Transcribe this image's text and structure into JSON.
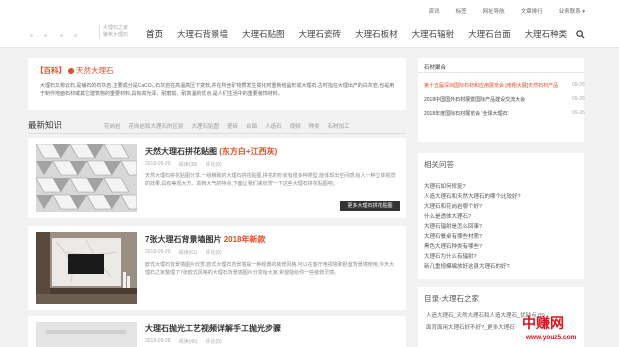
{
  "topbar": {
    "links": [
      "资讯",
      "标签",
      "网址导航",
      "文章排行",
      "业务联系 ▾"
    ]
  },
  "header": {
    "slogan_line1": "大理石之家",
    "slogan_line2": "聚焦大理石",
    "nav": [
      "首页",
      "大理石背景墙",
      "大理石贴图",
      "大理石瓷砖",
      "大理石板材",
      "大理石辐射",
      "大理石台面",
      "大理石种类"
    ],
    "search_icon": "search-icon"
  },
  "intro": {
    "tag": "【百科】",
    "brand": "天然大理石",
    "text": "大理石又称云石,是铺石的石灰岩,主要成分是CaCO₃,石灰岩在高温高压下变软,并在所含矿物质发生变化时重新结晶形成大理石.古时指在大理出产的白灰岩,也是用于制作地面石材或其它建筑物的重要材料,具有高光泽、耐磨损、耐高温的优点,是人们生活中的重要装饰材料。"
  },
  "tabs": {
    "title": "最新知识",
    "items": [
      "花岗岩",
      "花岗岩和大理石的区别",
      "大理石贴图",
      "瓷砖",
      "台面",
      "人造石",
      "视频",
      "种类",
      "石材加工"
    ]
  },
  "cards": [
    {
      "title": "天然大理石拼花贴图",
      "title_red": "(东方白+江西灰)",
      "date": "2018-09-29",
      "views": "阅读(39)",
      "comments": "评论(0)",
      "desc": "天然大理石拼花贴图分享,一组精致的大理石拼花贴图,拼花的形状有很多种类型,能体现出空间感,给人一种立体视觉的效果,具有美观大方、高档大气的特点,下面让我们来欣赏一下这些大理石拼花贴图吧。"
    },
    {
      "title": "7张大理石背景墙图片",
      "title_red": "2018年新款",
      "date": "2018-09-29",
      "views": "阅读(61)",
      "comments": "评论(0)",
      "desc": "欧式大理石背景墙图片欣赏,欧式大理石背景墙是一种经典的装修风格,可以在客厅电视墙和卧室背景墙使用,今天大理石之家整理了7张欧式风格的大理石背景墙图片分享给大家,希望能给你一些装修灵感。"
    },
    {
      "title": "大理石抛光工艺视频详解手工抛光步骤",
      "title_red": "",
      "date": "2018-09-28",
      "views": "阅读(45)",
      "comments": "评论(0)",
      "desc": ""
    }
  ],
  "tooltip": "更多大理石拼花贴图",
  "sidebar": {
    "box1": {
      "head": "石材聚合",
      "items": [
        {
          "text": "第十五届深圳国际石材和应用展览会 [南翔大展]天然石材产品",
          "date": "09-26",
          "hot": true
        },
        {
          "text": "2018中国国外石材展暨国际产品建设交流大会",
          "date": "09-26",
          "hot": false
        },
        {
          "text": "2018年度国际石材展览会 '全球大理石'",
          "date": "09-26",
          "hot": false
        }
      ]
    },
    "box2": {
      "title": "相关问答",
      "items": [
        "大理石如何修复?",
        "人造大理石和天然大理石的哪个比较好?",
        "大理石和花岗岩哪个好?",
        "什么是透体大理石?",
        "大理石辐射是怎么回事?",
        "大理石餐桌有哪些材质?",
        "黑色大理石种类有哪些?",
        "大理石为什么有辐射?",
        "新几重规模编放好这县大理石的好?"
      ]
    },
    "box3": {
      "title": "目录-大理石之家",
      "items": [
        "人造大理石_天然大理石和人造大理石_优缺点 (5)",
        "面背面用大理石好不好?_更多大理石"
      ]
    }
  },
  "watermark": {
    "logo": "中赚网",
    "url": "www.youz5.com"
  }
}
